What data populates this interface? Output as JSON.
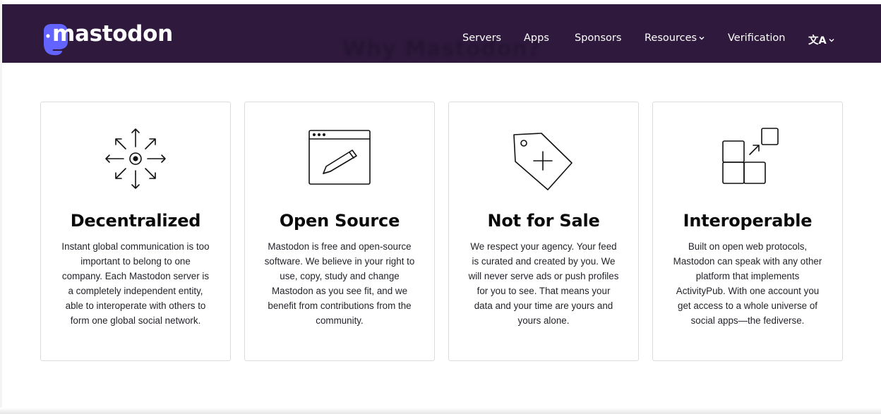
{
  "header": {
    "logo_text": "mastodon",
    "background_heading": "Why Mastodon?",
    "nav": [
      {
        "label": "Servers"
      },
      {
        "label": "Apps"
      },
      {
        "label": "Sponsors"
      },
      {
        "label": "Resources",
        "has_dropdown": true
      },
      {
        "label": "Verification"
      },
      {
        "label": "文A",
        "has_dropdown": true,
        "icon": "language-icon"
      }
    ]
  },
  "features": [
    {
      "icon": "decentralized-arrows-icon",
      "title": "Decentralized",
      "description": "Instant global communication is too important to belong to one company. Each Mastodon server is a completely independent entity, able to interoperate with others to form one global social network."
    },
    {
      "icon": "browser-pencil-icon",
      "title": "Open Source",
      "description": "Mastodon is free and open-source software. We believe in your right to use, copy, study and change Mastodon as you see fit, and we benefit from contributions from the community."
    },
    {
      "icon": "price-tag-plus-icon",
      "title": "Not for Sale",
      "description": "We respect your agency. Your feed is curated and created by you. We will never serve ads or push profiles for you to see. That means your data and your time are yours and yours alone."
    },
    {
      "icon": "interoperable-blocks-icon",
      "title": "Interoperable",
      "description": "Built on open web protocols, Mastodon can speak with any other platform that implements ActivityPub. With one account you get access to a whole universe of social apps—the fediverse."
    }
  ],
  "colors": {
    "navbar_bg": "#2f1a3d",
    "logo_purple": "#6364ff",
    "text_dark": "#0a0a0a",
    "card_border": "#dcdcdc"
  }
}
